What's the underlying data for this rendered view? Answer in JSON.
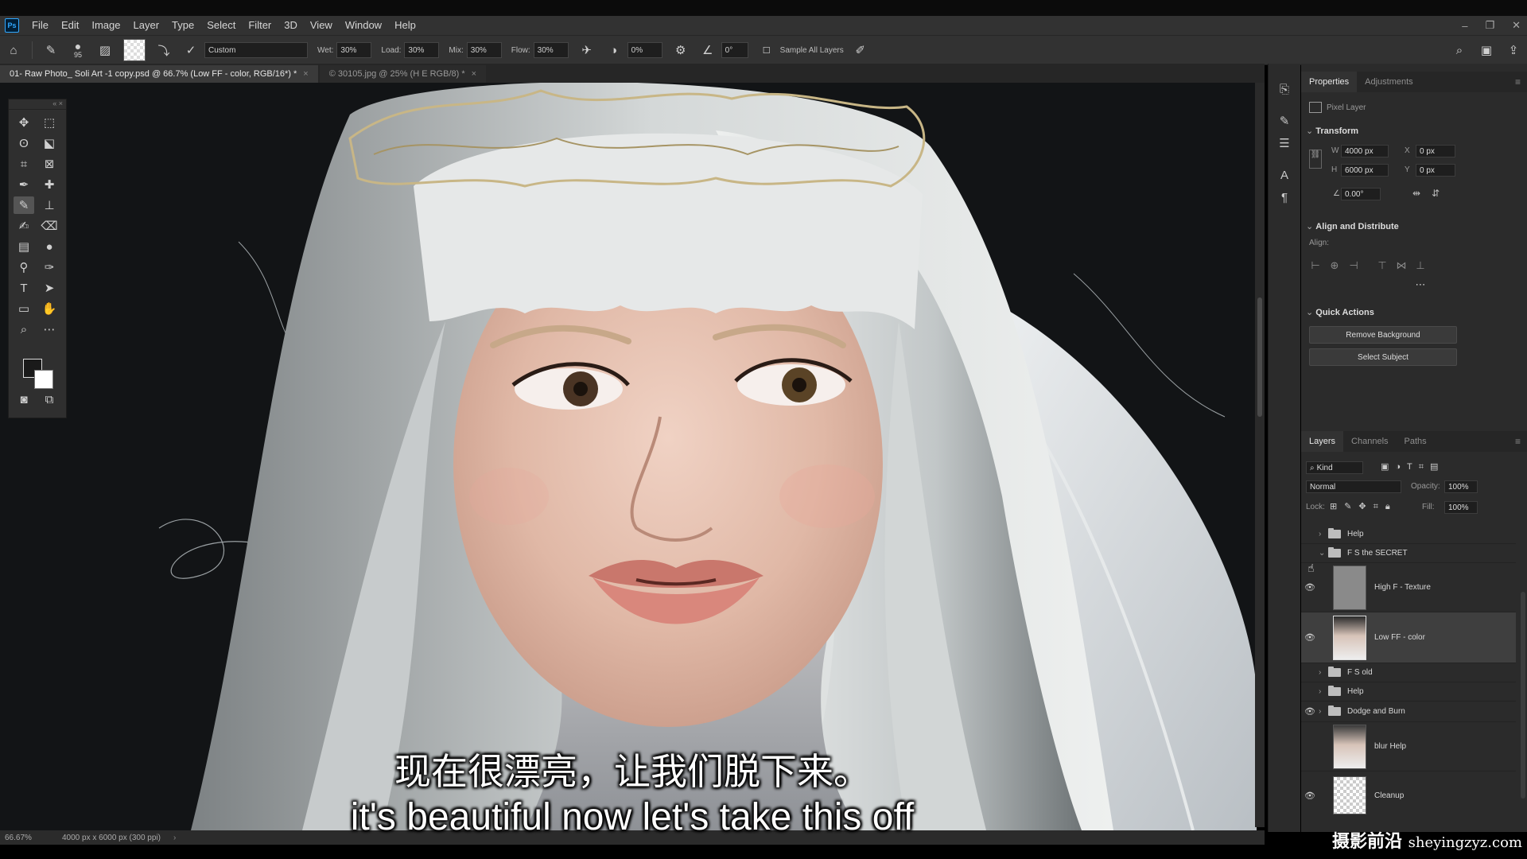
{
  "menubar": {
    "logo": "Ps",
    "items": [
      "File",
      "Edit",
      "Image",
      "Layer",
      "Type",
      "Select",
      "Filter",
      "3D",
      "View",
      "Window",
      "Help"
    ],
    "window_controls": [
      "–",
      "❐",
      "✕"
    ]
  },
  "options": {
    "brush_size": "95",
    "preset": "Custom",
    "wet_label": "Wet:",
    "wet": "30%",
    "load_label": "Load:",
    "load": "30%",
    "mix_label": "Mix:",
    "mix": "30%",
    "flow_label": "Flow:",
    "flow": "30%",
    "smoothing": "0%",
    "angle": "0°",
    "sample_all": "Sample All Layers"
  },
  "tabs": [
    {
      "label": "01- Raw Photo_ Soli Art -1 copy.psd @ 66.7% (Low FF - color, RGB/16*) *",
      "active": true
    },
    {
      "label": "© 30105.jpg @ 25% (H E RGB/8) *",
      "active": false
    }
  ],
  "status": {
    "zoom": "66.67%",
    "doc_info": "4000 px x 6000 px (300 ppi)"
  },
  "properties": {
    "tabs": [
      "Properties",
      "Adjustments"
    ],
    "layer_type": "Pixel Layer",
    "transform_title": "Transform",
    "w_label": "W",
    "w": "4000 px",
    "h_label": "H",
    "h": "6000 px",
    "x_label": "X",
    "x": "0 px",
    "y_label": "Y",
    "y": "0 px",
    "angle": "0.00°",
    "align_title": "Align and Distribute",
    "align_label": "Align:",
    "quick_actions_title": "Quick Actions",
    "remove_bg": "Remove Background",
    "select_subject": "Select Subject"
  },
  "layers_panel": {
    "tabs": [
      "Layers",
      "Channels",
      "Paths"
    ],
    "kind": "Kind",
    "blend_mode": "Normal",
    "opacity_label": "Opacity:",
    "opacity": "100%",
    "lock_label": "Lock:",
    "fill_label": "Fill:",
    "fill": "100%",
    "layers": [
      {
        "name": "Help",
        "type": "group",
        "visible": false
      },
      {
        "name": "F S the SECRET",
        "type": "group-open",
        "visible": false
      },
      {
        "name": "High F - Texture",
        "type": "pixel-gray",
        "visible": true
      },
      {
        "name": "Low FF - color",
        "type": "pixel-photo",
        "visible": true,
        "selected": true
      },
      {
        "name": "F S old",
        "type": "group",
        "visible": false
      },
      {
        "name": "Help",
        "type": "group",
        "visible": false
      },
      {
        "name": "Dodge and Burn",
        "type": "group",
        "visible": true
      },
      {
        "name": "blur Help",
        "type": "pixel-photo",
        "visible": false
      },
      {
        "name": "Cleanup",
        "type": "pixel-transparent",
        "visible": true
      }
    ]
  },
  "subtitles": {
    "zh": "现在很漂亮，让我们脱下来。",
    "en": "it's beautiful now let's take this off"
  },
  "watermark": {
    "name": "摄影前沿",
    "url": "sheyingzyz.com"
  }
}
